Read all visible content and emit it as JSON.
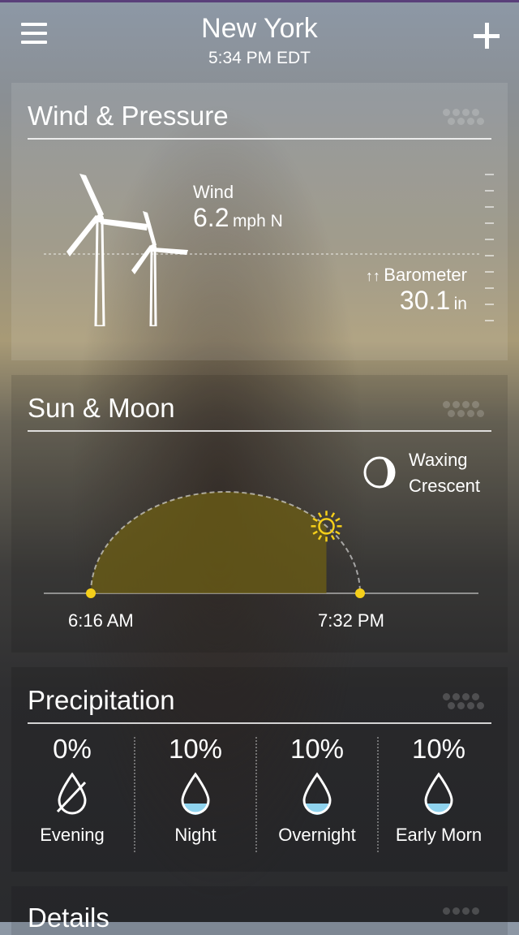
{
  "header": {
    "city": "New York",
    "time": "5:34 PM EDT"
  },
  "wind_pressure": {
    "title": "Wind & Pressure",
    "wind_label": "Wind",
    "wind_speed": "6.2",
    "wind_unit": "mph N",
    "barometer_arrows": "↑↑",
    "barometer_label": "Barometer",
    "barometer_value": "30.1",
    "barometer_unit": "in"
  },
  "sun_moon": {
    "title": "Sun & Moon",
    "moon_phase_line1": "Waxing",
    "moon_phase_line2": "Crescent",
    "sunrise": "6:16 AM",
    "sunset": "7:32 PM",
    "sun_accent": "#f5cf1a",
    "day_progress": 0.77
  },
  "precipitation": {
    "title": "Precipitation",
    "columns": [
      {
        "pct": "0%",
        "label": "Evening",
        "icon": "no-rain-drop-icon"
      },
      {
        "pct": "10%",
        "label": "Night",
        "icon": "rain-drop-icon"
      },
      {
        "pct": "10%",
        "label": "Overnight",
        "icon": "rain-drop-icon"
      },
      {
        "pct": "10%",
        "label": "Early Morn",
        "icon": "rain-drop-icon"
      }
    ]
  },
  "details": {
    "title": "Details"
  }
}
